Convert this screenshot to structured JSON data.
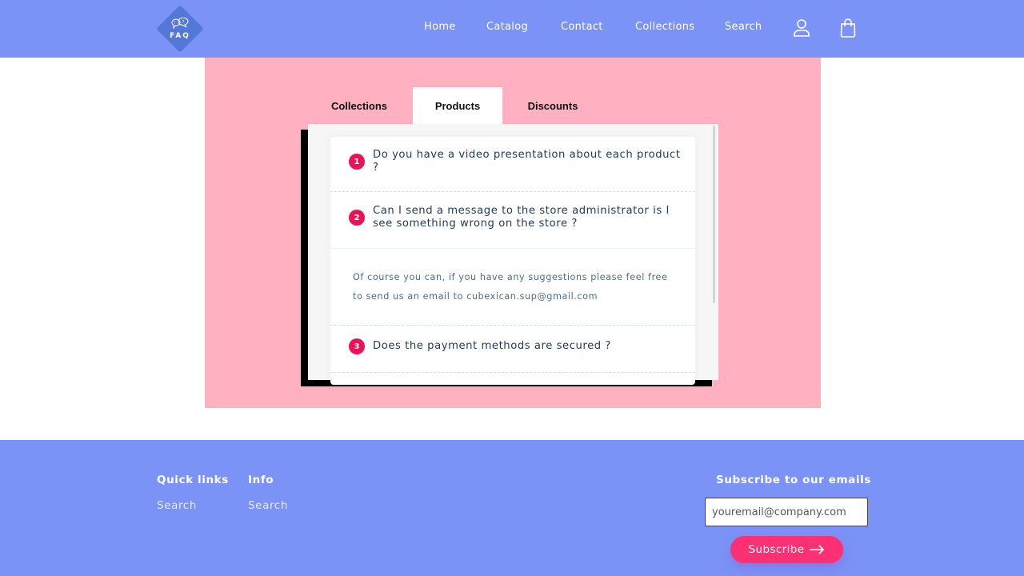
{
  "header": {
    "logo_text": "FAQ",
    "logo_icon": "speech-bubbles-icon",
    "nav": [
      {
        "label": "Home"
      },
      {
        "label": "Catalog"
      },
      {
        "label": "Contact"
      },
      {
        "label": "Collections"
      },
      {
        "label": "Search"
      }
    ],
    "account_icon": "user-icon",
    "cart_icon": "shopping-bag-icon"
  },
  "faq": {
    "tabs": [
      {
        "label": "Collections",
        "active": false
      },
      {
        "label": "Products",
        "active": true
      },
      {
        "label": "Discounts",
        "active": false
      }
    ],
    "items": [
      {
        "number": "1",
        "question": "Do you have a video presentation about each product ?",
        "expanded": false
      },
      {
        "number": "2",
        "question": "Can I send a message to the store administrator is I see something wrong on the store ?",
        "expanded": true,
        "answer_line1": "Of course you can, if you have any suggestions please feel free",
        "answer_line2": "to send us an email to cubexican.sup@gmail.com"
      },
      {
        "number": "3",
        "question": "Does the payment methods are secured ?",
        "expanded": false
      }
    ]
  },
  "footer": {
    "quick_links": {
      "heading": "Quick links",
      "links": [
        {
          "label": "Search"
        }
      ]
    },
    "info": {
      "heading": "Info",
      "links": [
        {
          "label": "Search"
        }
      ]
    },
    "newsletter": {
      "heading": "Subscribe to our emails",
      "email_placeholder": "youremail@company.com",
      "button_label": "Subscribe",
      "button_icon": "arrow-right-icon"
    }
  },
  "colors": {
    "header_bg": "#7b93f7",
    "pink_bg": "#ffb1c2",
    "number_badge": "#ed1157",
    "subscribe_button": "#fe3074"
  }
}
